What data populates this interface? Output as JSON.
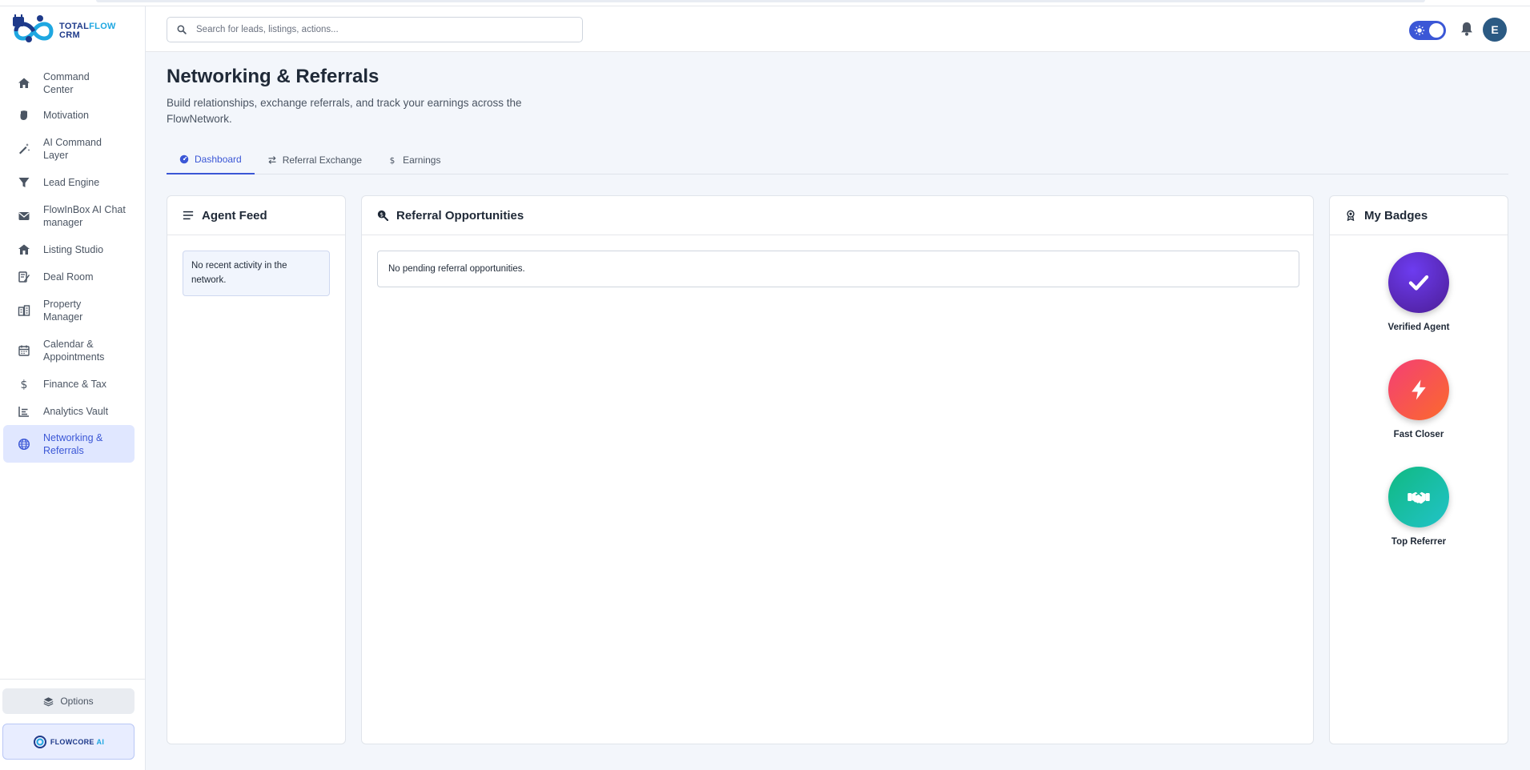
{
  "brand": {
    "line1_a": "TOTAL",
    "line1_b": "FLOW",
    "line2": "CRM"
  },
  "nav": {
    "items": [
      {
        "label": "Command Center",
        "icon": "home-icon"
      },
      {
        "label": "Motivation",
        "icon": "fist-icon"
      },
      {
        "label": "AI Command Layer",
        "icon": "magic-wand-icon"
      },
      {
        "label": "Lead Engine",
        "icon": "funnel-icon"
      },
      {
        "label": "FlowInBox AI Chat manager",
        "icon": "envelope-icon"
      },
      {
        "label": "Listing Studio",
        "icon": "house-icon"
      },
      {
        "label": "Deal Room",
        "icon": "signature-icon"
      },
      {
        "label": "Property Manager",
        "icon": "building-icon"
      },
      {
        "label": "Calendar & Appointments",
        "icon": "calendar-icon"
      },
      {
        "label": "Finance & Tax",
        "icon": "dollar-icon"
      },
      {
        "label": "Analytics Vault",
        "icon": "chart-icon"
      },
      {
        "label": "Networking & Referrals",
        "icon": "globe-icon",
        "active": true
      }
    ],
    "options_label": "Options",
    "flowcore_a": "FLOWCORE",
    "flowcore_b": "AI"
  },
  "header": {
    "search_placeholder": "Search for leads, listings, actions...",
    "avatar_initial": "E"
  },
  "page": {
    "title": "Networking & Referrals",
    "subtitle": "Build relationships, exchange referrals, and track your earnings across the FlowNetwork."
  },
  "tabs": [
    {
      "label": "Dashboard",
      "active": true
    },
    {
      "label": "Referral Exchange"
    },
    {
      "label": "Earnings"
    }
  ],
  "feed": {
    "title": "Agent Feed",
    "empty": "No recent activity in the network."
  },
  "referrals": {
    "title": "Referral Opportunities",
    "empty": "No pending referral opportunities."
  },
  "badges": {
    "title": "My Badges",
    "items": [
      {
        "name": "Verified Agent",
        "icon": "check-icon",
        "color": "#5b21b6"
      },
      {
        "name": "Fast Closer",
        "icon": "bolt-icon",
        "color": "#f43f5e"
      },
      {
        "name": "Top Referrer",
        "icon": "handshake-icon",
        "color": "#10b981"
      }
    ]
  },
  "colors": {
    "accent": "#3b57d6",
    "active_nav_bg": "#e0e7ff"
  }
}
